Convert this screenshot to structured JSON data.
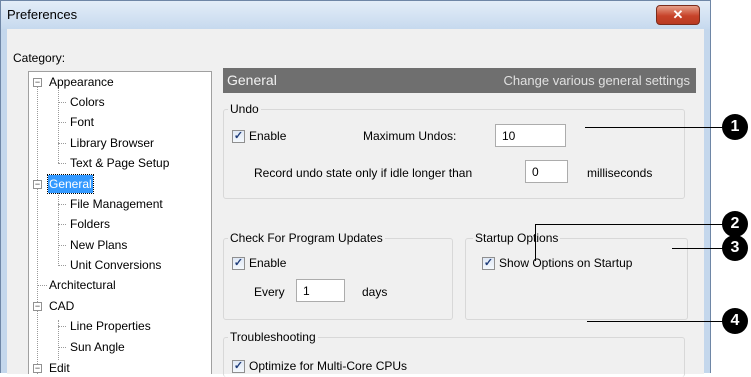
{
  "window": {
    "title": "Preferences",
    "close_glyph": "✕"
  },
  "category_label": "Category:",
  "tree": {
    "appearance": "Appearance",
    "colors": "Colors",
    "font": "Font",
    "library_browser": "Library Browser",
    "text_page_setup": "Text & Page Setup",
    "general": "General",
    "file_management": "File Management",
    "folders": "Folders",
    "new_plans": "New Plans",
    "unit_conversions": "Unit Conversions",
    "architectural": "Architectural",
    "cad": "CAD",
    "line_properties": "Line Properties",
    "sun_angle": "Sun Angle",
    "edit": "Edit",
    "expander_symbol": "−"
  },
  "panel": {
    "title": "General",
    "description": "Change various general settings"
  },
  "undo": {
    "group_label": "Undo",
    "enable_label": "Enable",
    "enable_checked": true,
    "max_label": "Maximum Undos:",
    "max_value": "10",
    "idle_label": "Record undo state only if idle longer than",
    "idle_value": "0",
    "idle_unit": "milliseconds"
  },
  "updates": {
    "group_label": "Check For Program Updates",
    "enable_label": "Enable",
    "enable_checked": true,
    "every_label": "Every",
    "every_value": "1",
    "days_label": "days"
  },
  "startup": {
    "group_label": "Startup Options",
    "show_label": "Show Options on Startup",
    "show_checked": true
  },
  "troubleshooting": {
    "group_label": "Troubleshooting",
    "multicore_label": "Optimize for Multi-Core CPUs",
    "multicore_checked": true
  },
  "callouts": [
    "1",
    "2",
    "3",
    "4"
  ],
  "check_glyph": "✓"
}
